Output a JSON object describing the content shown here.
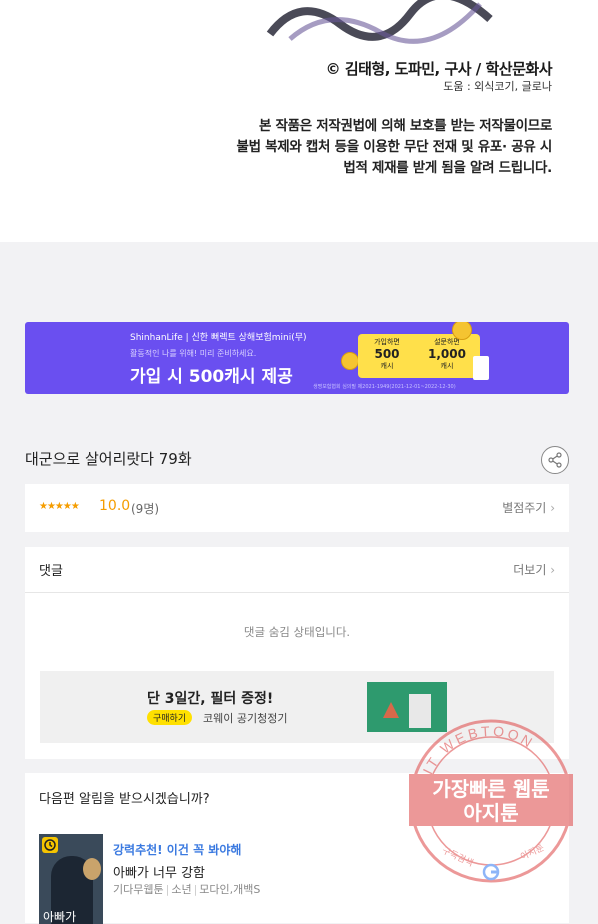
{
  "episode_footer": {
    "copyright": "© 김태형, 도파민, 구사 / 학산문화사",
    "assist": "도움 : 외식코기, 글로나",
    "notice_lines": [
      "본 작품은 저작권법에 의해 보호를 받는 저작물이므로",
      "불법 복제와 캡처 등을 이용한 무단 전재 및 유포· 공유 시",
      "법적 제재를 받게 됨을 알려 드립니다."
    ]
  },
  "banner": {
    "brand": "ShinhanLife | 신한 뻐렉트 상해보험mini(무)",
    "subtitle": "활동적인 나를 위해! 미리 준비하세요.",
    "headline": "가입 시 500캐시 제공",
    "coupon_left_label": "가입하면",
    "coupon_left_value": "500",
    "coupon_left_unit": "캐시",
    "coupon_right_label": "설문하면",
    "coupon_right_value": "1,000",
    "coupon_right_unit": "캐시",
    "fine_print": "생명보험협회 심의필 제2021-1949(2021-12-01~2022-12-30)",
    "color": "#6a4ff0"
  },
  "episode": {
    "title": "대군으로 살어리랏다 79화"
  },
  "rating": {
    "stars": "★★★★★",
    "score": "10.0",
    "count": "(9명)",
    "rate_link": "별점주기"
  },
  "comments": {
    "title": "댓글",
    "more": "더보기",
    "empty_message": "댓글 숨김 상태입니다."
  },
  "ad": {
    "title": "단 3일간, 필터 증정!",
    "badge": "구매하기",
    "subtitle": "코웨이 공기청정기"
  },
  "notify": {
    "question": "다음편 알림을 받으시겠습니까?"
  },
  "recommend": {
    "tag": "강력추천! 이건 꼭 봐야해",
    "name": "아빠가 너무 강함",
    "meta": [
      "기다무웹툰",
      "소년",
      "모다인,개백S"
    ],
    "thumb_text": "아빠가"
  },
  "watermark": {
    "ring_text": "AGIT WEBTOON",
    "line1": "가장빠른 웹툰",
    "line2": "아지툰",
    "bottom_left": "구독검색",
    "bottom_right": "아지툰"
  },
  "colors": {
    "accent_star": "#f59d00",
    "link_blue": "#3b7ae0",
    "page_bg": "#f2f2f4"
  }
}
